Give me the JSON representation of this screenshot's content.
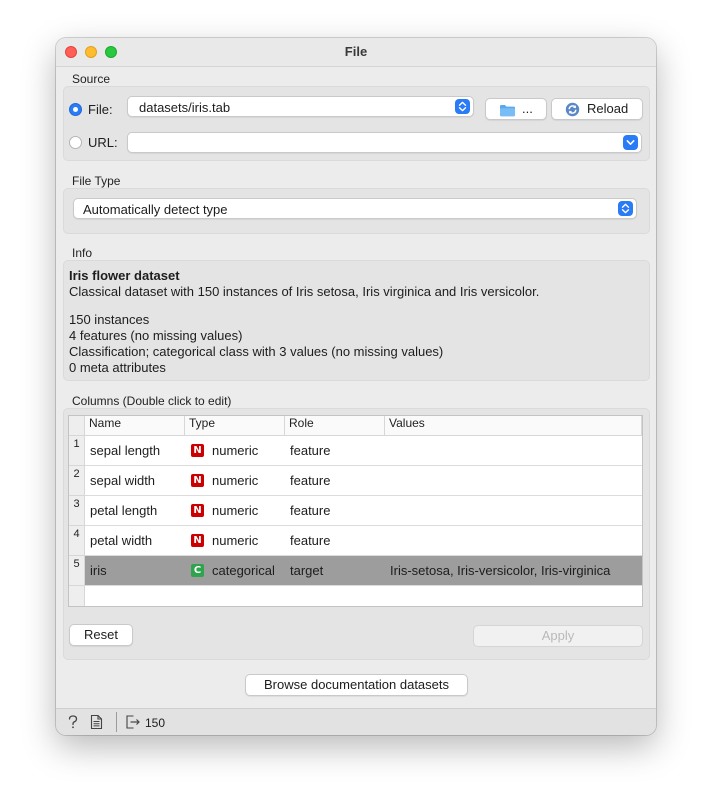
{
  "window": {
    "title": "File"
  },
  "source": {
    "label": "Source",
    "file_label": "File:",
    "file_value": "datasets/iris.tab",
    "browse_label": "...",
    "reload_label": "Reload",
    "url_label": "URL:",
    "url_value": ""
  },
  "file_type": {
    "label": "File Type",
    "value": "Automatically detect type"
  },
  "info": {
    "label": "Info",
    "title": "Iris flower dataset",
    "description": "Classical dataset with 150 instances of Iris setosa, Iris virginica and Iris versicolor.",
    "lines": [
      "150 instances",
      "4 features (no missing values)",
      "Classification; categorical class with 3 values (no missing values)",
      "0 meta attributes"
    ]
  },
  "columns": {
    "label": "Columns (Double click to edit)",
    "headers": [
      "Name",
      "Type",
      "Role",
      "Values"
    ],
    "rows": [
      {
        "index": "1",
        "name": "sepal length",
        "badge": "N",
        "type": "numeric",
        "role": "feature",
        "values": ""
      },
      {
        "index": "2",
        "name": "sepal width",
        "badge": "N",
        "type": "numeric",
        "role": "feature",
        "values": ""
      },
      {
        "index": "3",
        "name": "petal length",
        "badge": "N",
        "type": "numeric",
        "role": "feature",
        "values": ""
      },
      {
        "index": "4",
        "name": "petal width",
        "badge": "N",
        "type": "numeric",
        "role": "feature",
        "values": ""
      },
      {
        "index": "5",
        "name": "iris",
        "badge": "C",
        "type": "categorical",
        "role": "target",
        "values": "Iris-setosa, Iris-versicolor, Iris-virginica"
      }
    ],
    "reset_label": "Reset",
    "apply_label": "Apply"
  },
  "browse_docs_label": "Browse documentation datasets",
  "status": {
    "output_count": "150"
  },
  "colors": {
    "accent": "#2a7cf6",
    "selected_row": "#9d9d9d",
    "numeric_badge": "#cc0000",
    "categorical_badge": "#2ea44f"
  }
}
